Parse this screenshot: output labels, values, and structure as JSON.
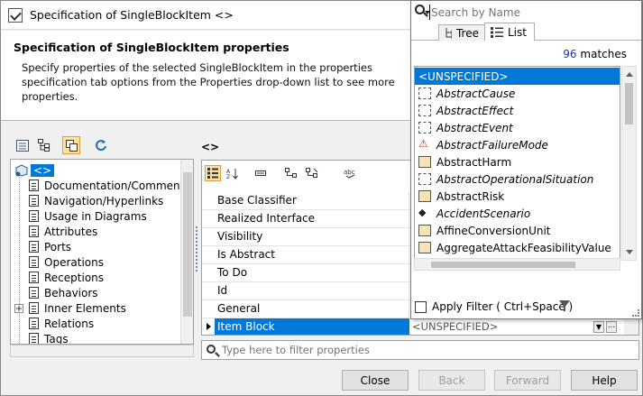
{
  "window": {
    "title": "Specification of SingleBlockItem <>"
  },
  "header": {
    "title": "Specification of SingleBlockItem properties",
    "description": "Specify properties of the selected SingleBlockItem in the properties specification tab options from the Properties drop-down list to see more properties."
  },
  "toolbar": {
    "icons": [
      "show-specification-icon",
      "tree-structure-icon",
      "copy-icon",
      "refresh-icon"
    ]
  },
  "path_label": "<>",
  "tree": {
    "root_label": "<>",
    "items": [
      {
        "label": "Documentation/Comments",
        "expandable": false
      },
      {
        "label": "Navigation/Hyperlinks",
        "expandable": false
      },
      {
        "label": "Usage in Diagrams",
        "expandable": false
      },
      {
        "label": "Attributes",
        "expandable": false
      },
      {
        "label": "Ports",
        "expandable": false
      },
      {
        "label": "Operations",
        "expandable": false
      },
      {
        "label": "Receptions",
        "expandable": false
      },
      {
        "label": "Behaviors",
        "expandable": false
      },
      {
        "label": "Inner Elements",
        "expandable": true
      },
      {
        "label": "Relations",
        "expandable": false
      },
      {
        "label": "Tags",
        "expandable": false
      }
    ]
  },
  "properties": {
    "rows": [
      {
        "name": "Base Classifier"
      },
      {
        "name": "Realized Interface"
      },
      {
        "name": "Visibility"
      },
      {
        "name": "Is Abstract"
      },
      {
        "name": "To Do"
      },
      {
        "name": "Id"
      },
      {
        "name": "General"
      },
      {
        "name": "Item Block",
        "value": "<UNSPECIFIED>",
        "selected": true
      }
    ],
    "filter_placeholder": "Type here to filter properties"
  },
  "buttons": {
    "close": "Close",
    "back": "Back",
    "forward": "Forward",
    "help": "Help"
  },
  "popup": {
    "search_placeholder": "Search by Name",
    "tab_tree": "Tree",
    "tab_list": "List",
    "match_count": "96",
    "match_suffix": "matches",
    "items": [
      {
        "label": "<UNSPECIFIED>",
        "selected": true,
        "italic": false,
        "icon": "none"
      },
      {
        "label": "AbstractCause",
        "italic": true,
        "icon": "dashed-block-icon"
      },
      {
        "label": "AbstractEffect",
        "italic": true,
        "icon": "dashed-block-icon"
      },
      {
        "label": "AbstractEvent",
        "italic": true,
        "icon": "dashed-block-icon"
      },
      {
        "label": "AbstractFailureMode",
        "italic": true,
        "icon": "warning-icon"
      },
      {
        "label": "AbstractHarm",
        "italic": false,
        "icon": "block-icon"
      },
      {
        "label": "AbstractOperationalSituation",
        "italic": true,
        "icon": "dashed-block-icon"
      },
      {
        "label": "AbstractRisk",
        "italic": false,
        "icon": "block-icon"
      },
      {
        "label": "AccidentScenario",
        "italic": true,
        "icon": "scenario-icon"
      },
      {
        "label": "AffineConversionUnit",
        "italic": false,
        "icon": "block-icon"
      },
      {
        "label": "AggregateAttackFeasibilityValue",
        "italic": false,
        "icon": "block-icon"
      }
    ],
    "apply_filter_label": "Apply Filter ( Ctrl+Space )"
  }
}
